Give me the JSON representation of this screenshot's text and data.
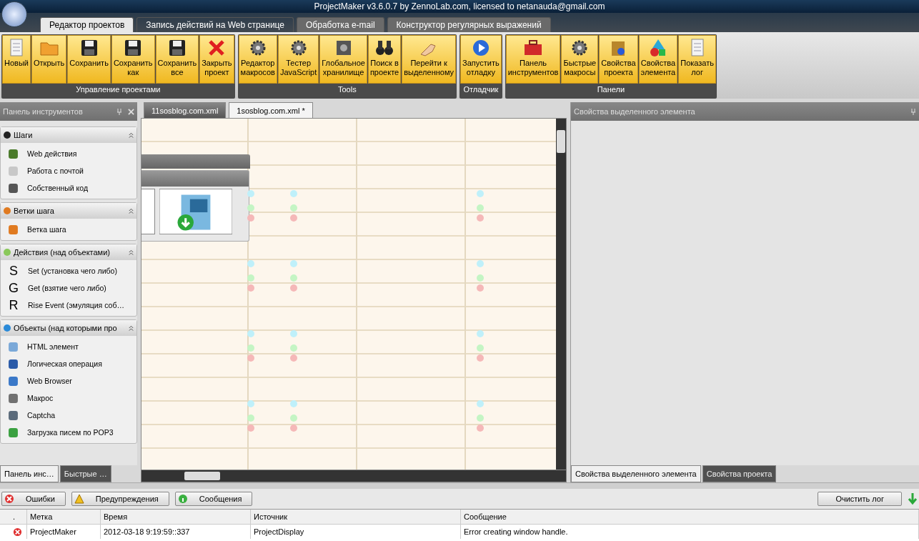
{
  "window": {
    "title": "ProjectMaker v3.6.0.7 by ZennoLab.com, licensed to netanauda@gmail.com"
  },
  "ribbon_tabs": [
    {
      "label": "Редактор проектов",
      "selected": true
    },
    {
      "label": "Запись действий на Web странице",
      "selected": false
    },
    {
      "label": "Обработка e-mail",
      "selected": false
    },
    {
      "label": "Конструктор регулярных выражений",
      "selected": false
    }
  ],
  "ribbon_groups": [
    {
      "title": "Управление проектами",
      "buttons": [
        {
          "label": "Новый"
        },
        {
          "label": "Открыть"
        },
        {
          "label": "Сохранить"
        },
        {
          "label": "Сохранить\nкак"
        },
        {
          "label": "Сохранить\nвсе"
        },
        {
          "label": "Закрыть\nпроект"
        }
      ]
    },
    {
      "title": "Tools",
      "buttons": [
        {
          "label": "Редактор\nмакросов"
        },
        {
          "label": "Тестер\nJavaScript"
        },
        {
          "label": "Глобальное\nхранилище"
        },
        {
          "label": "Поиск в\nпроекте"
        },
        {
          "label": "Перейти к\nвыделенному"
        }
      ]
    },
    {
      "title": "Отладчик",
      "buttons": [
        {
          "label": "Запустить\nотладку"
        }
      ]
    },
    {
      "title": "Панели",
      "buttons": [
        {
          "label": "Панель\nинструментов"
        },
        {
          "label": "Быстрые\nмакросы"
        },
        {
          "label": "Свойства\nпроекта"
        },
        {
          "label": "Свойства\nэлемента"
        },
        {
          "label": "Показать\nлог"
        }
      ]
    }
  ],
  "toolbox": {
    "title": "Панель инструментов",
    "sections": [
      {
        "title": "Шаги",
        "expanded": true,
        "items": [
          {
            "label": "Web действия",
            "kind": "icon",
            "color": "#4a7a2a"
          },
          {
            "label": "Работа с почтой",
            "kind": "icon",
            "color": "#c8c8c8"
          },
          {
            "label": "Собственный код",
            "kind": "icon",
            "color": "#555555"
          }
        ]
      },
      {
        "title": "Ветки шага",
        "expanded": true,
        "items": [
          {
            "label": "Ветка шага",
            "kind": "icon",
            "color": "#e07a20"
          }
        ]
      },
      {
        "title": "Действия (над объектами)",
        "expanded": true,
        "items": [
          {
            "label": "Set (установка чего либо)",
            "kind": "letter",
            "glyph": "S"
          },
          {
            "label": "Get (взятие чего либо)",
            "kind": "letter",
            "glyph": "G"
          },
          {
            "label": "Rise Event (эмуляция соб…",
            "kind": "letter",
            "glyph": "R"
          }
        ]
      },
      {
        "title": "Объекты (над которыми про",
        "expanded": true,
        "items": [
          {
            "label": "HTML элемент",
            "kind": "icon",
            "color": "#7aa8d8"
          },
          {
            "label": "Логическая операция",
            "kind": "icon",
            "color": "#2a5aa8"
          },
          {
            "label": "Web Browser",
            "kind": "icon",
            "color": "#3a78c8"
          },
          {
            "label": "Макрос",
            "kind": "icon",
            "color": "#707070"
          },
          {
            "label": "Captcha",
            "kind": "icon",
            "color": "#5a6a7a"
          },
          {
            "label": "Загрузка писем по POP3",
            "kind": "icon",
            "color": "#3aa040"
          }
        ]
      }
    ],
    "bottom_tabs": [
      {
        "label": "Панель инс…",
        "selected": true
      },
      {
        "label": "Быстрые …",
        "selected": false
      }
    ]
  },
  "document_tabs": [
    {
      "label": "11sosblog.com.xml",
      "selected": false
    },
    {
      "label": "1sosblog.com.xml *",
      "selected": true
    }
  ],
  "properties_panel": {
    "title": "Свойства выделенного элемента",
    "bottom_tabs": [
      {
        "label": "Свойства выделенного элемента",
        "selected": true
      },
      {
        "label": "Свойства проекта",
        "selected": false
      }
    ]
  },
  "log": {
    "buttons": [
      {
        "label": "Ошибки"
      },
      {
        "label": "Предупреждения"
      },
      {
        "label": "Сообщения"
      }
    ],
    "clear_button": "Очистить лог",
    "columns": [
      ".",
      "Метка",
      "Время",
      "Источник",
      "Сообщение"
    ],
    "rows": [
      {
        "cells": [
          "",
          "ProjectMaker",
          "2012-03-18   9:19:59::337",
          "ProjectDisplay",
          "Error creating window handle."
        ]
      }
    ]
  }
}
